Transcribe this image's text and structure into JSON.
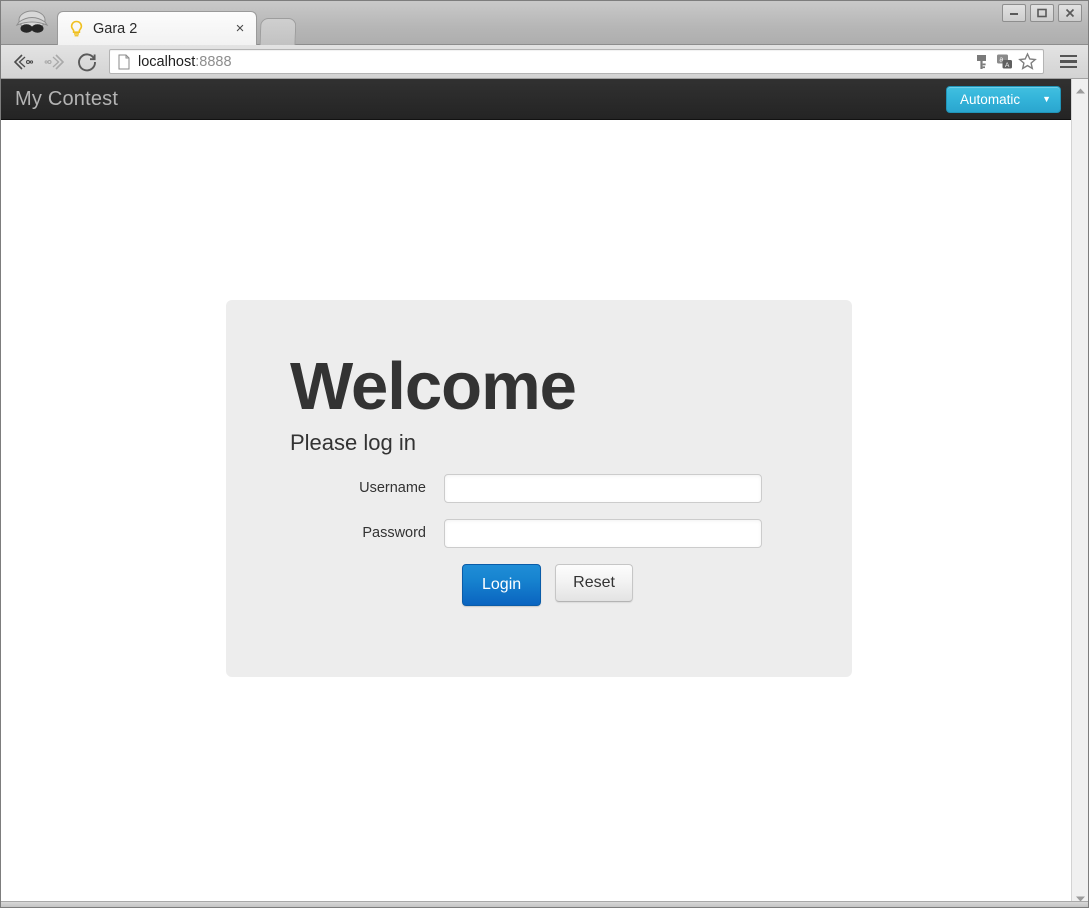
{
  "browser": {
    "incognito_icon": "incognito-icon",
    "tab": {
      "favicon": "lightbulb-favicon",
      "title": "Gara 2",
      "close_label": "×"
    },
    "new_tab_label": "",
    "window_controls": {
      "minimize": "minimize-icon",
      "maximize": "maximize-icon",
      "close": "close-icon"
    },
    "nav": {
      "back": "back-arrow-icon",
      "forward": "forward-arrow-icon",
      "reload": "reload-icon"
    },
    "omnibox": {
      "page_icon": "page-document-icon",
      "url_host": "localhost",
      "url_port": ":8888",
      "full_url": "localhost:8888",
      "icons": [
        "key-icon",
        "translate-icon",
        "bookmark-star-icon"
      ]
    },
    "menu_icon": "hamburger-menu-icon"
  },
  "page": {
    "header": {
      "site_title": "My Contest",
      "language_select": {
        "value": "Automatic",
        "caret": "▼",
        "accent_color": "#34b4da"
      }
    },
    "login_panel": {
      "heading": "Welcome",
      "subtitle": "Please log in",
      "fields": [
        {
          "label": "Username",
          "value": "",
          "placeholder": "",
          "name": "username-field"
        },
        {
          "label": "Password",
          "value": "",
          "placeholder": "",
          "name": "password-field"
        }
      ],
      "buttons": {
        "submit": "Login",
        "reset": "Reset"
      },
      "panel_bg": "#ededed",
      "submit_color": "#1784d0"
    },
    "scrollbar": {
      "up_arrow": "scroll-up-arrow-icon",
      "down_arrow": "scroll-down-arrow-icon"
    }
  }
}
